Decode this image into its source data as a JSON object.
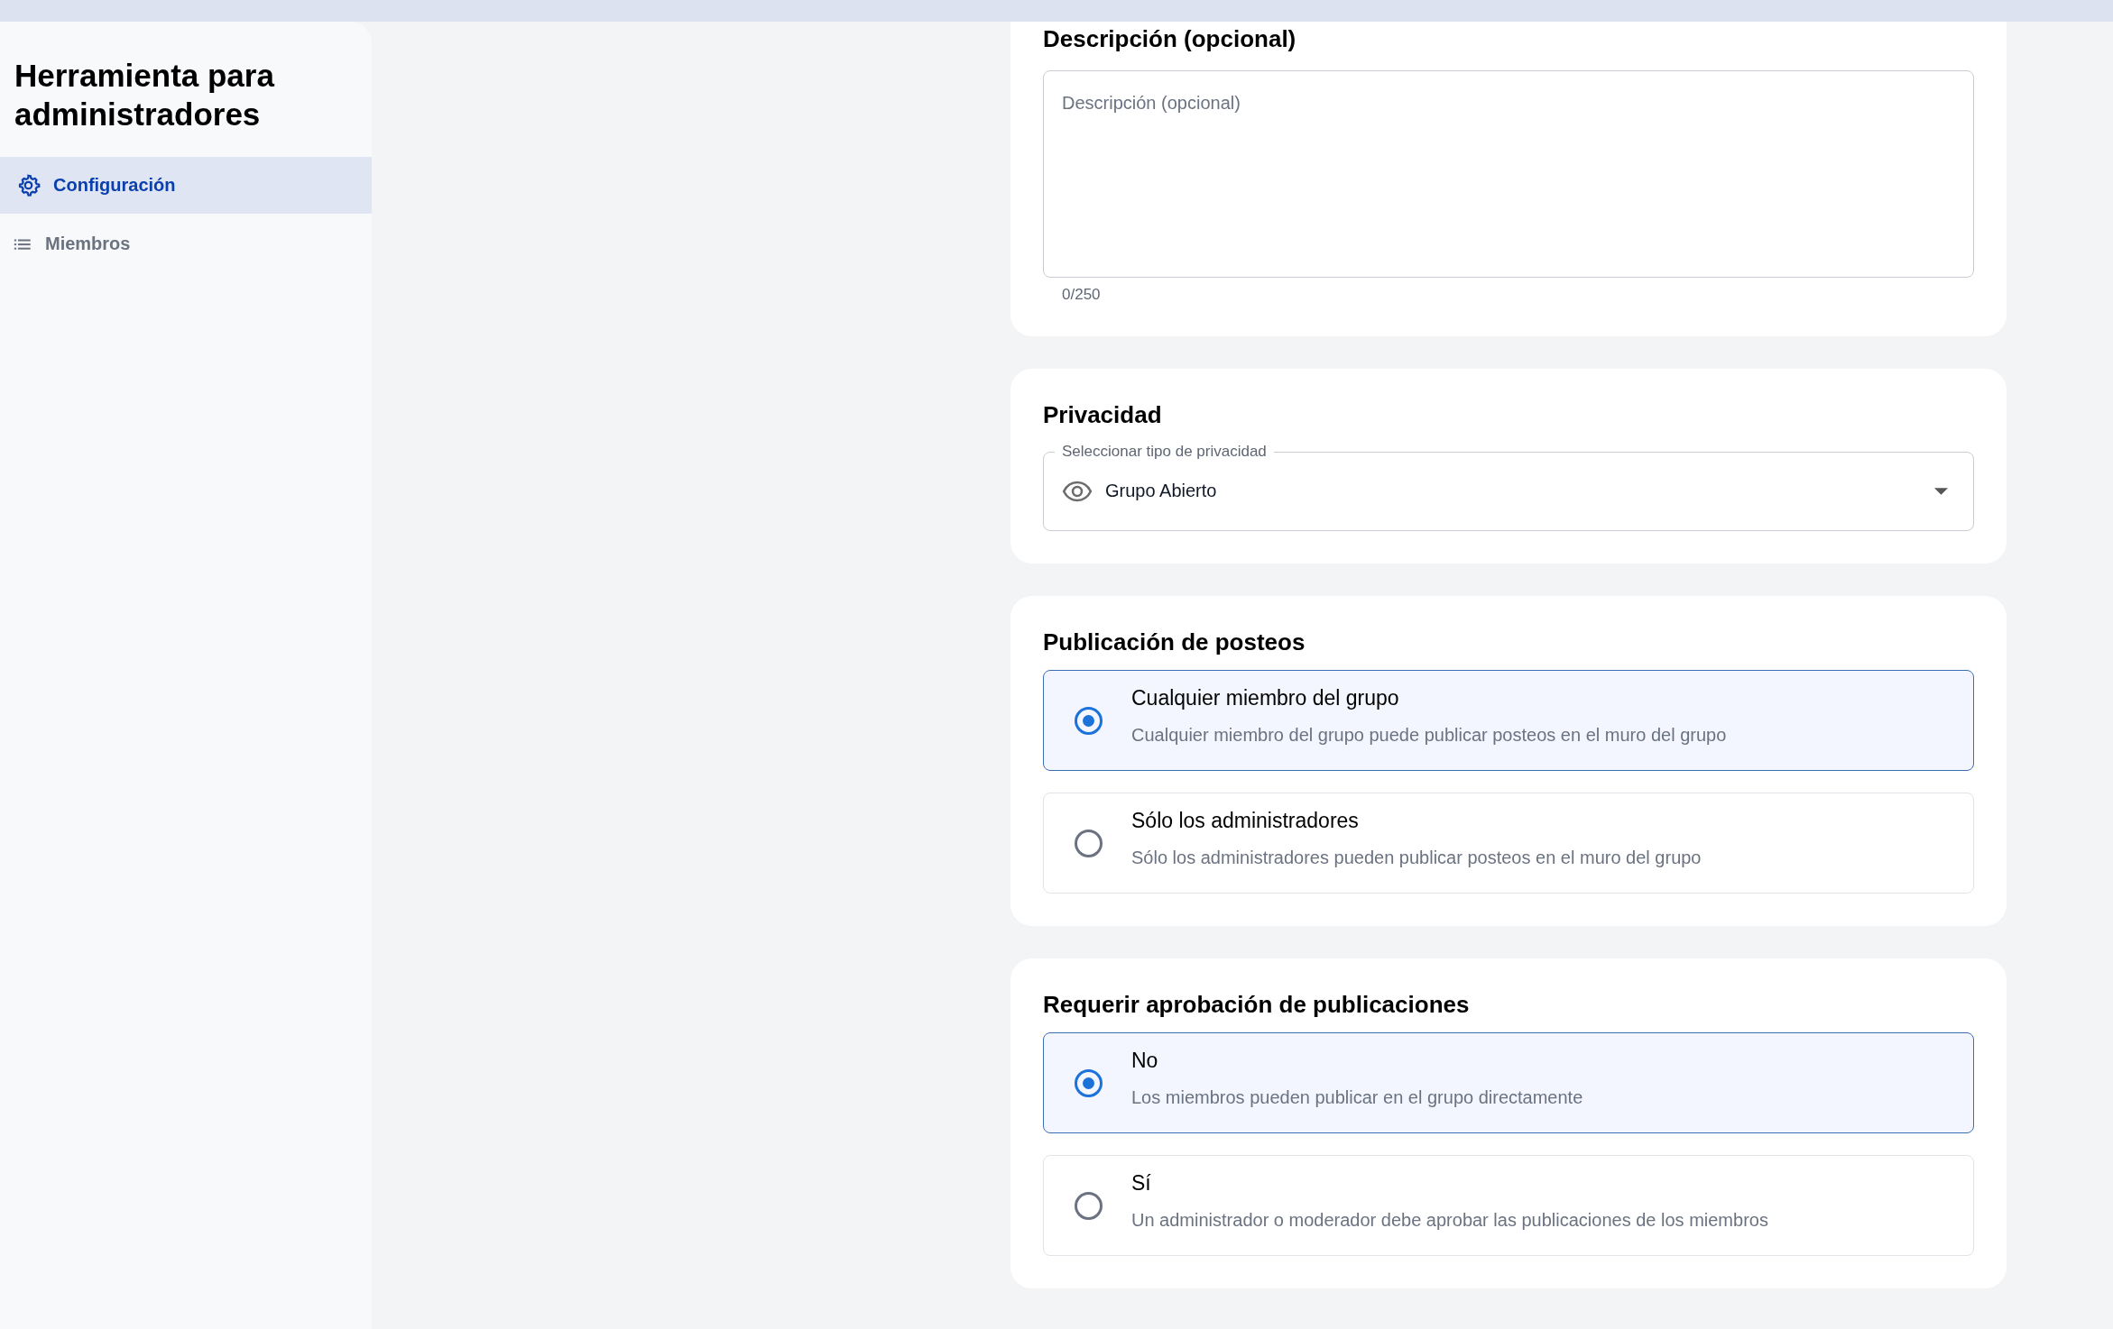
{
  "sidebar": {
    "title": "Herramienta para administradores",
    "items": [
      {
        "kind": "gear",
        "label": "Configuración",
        "selected": true
      },
      {
        "kind": "list",
        "label": "Miembros",
        "selected": false
      }
    ]
  },
  "description": {
    "heading": "Descripción (opcional)",
    "placeholder": "Descripción (opcional)",
    "counter": "0/250"
  },
  "privacy": {
    "heading": "Privacidad",
    "label": "Seleccionar tipo de privacidad",
    "value": "Grupo Abierto"
  },
  "radio_groups": [
    {
      "heading": "Publicación de posteos",
      "options": [
        {
          "title": "Cualquier miembro del grupo",
          "description": "Cualquier miembro del grupo puede publicar posteos en el muro del grupo",
          "selected": true
        },
        {
          "title": "Sólo los administradores",
          "description": "Sólo los administradores pueden publicar posteos en el muro del grupo",
          "selected": false
        }
      ]
    },
    {
      "heading": "Requerir aprobación de publicaciones",
      "options": [
        {
          "title": "No",
          "description": "Los miembros pueden publicar en el grupo directamente",
          "selected": true
        },
        {
          "title": "Sí",
          "description": "Un administrador o moderador debe aprobar las publicaciones de los miembros",
          "selected": false
        }
      ]
    }
  ]
}
